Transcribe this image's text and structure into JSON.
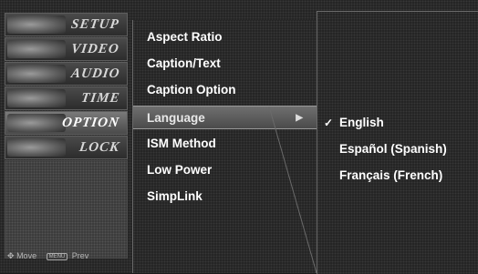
{
  "sidebar": {
    "items": [
      {
        "label": "SETUP",
        "icon": "setup-thumbnail-icon"
      },
      {
        "label": "VIDEO",
        "icon": "video-thumbnail-icon"
      },
      {
        "label": "AUDIO",
        "icon": "audio-thumbnail-icon"
      },
      {
        "label": "TIME",
        "icon": "time-thumbnail-icon"
      },
      {
        "label": "OPTION",
        "icon": "option-thumbnail-icon",
        "active": true
      },
      {
        "label": "LOCK",
        "icon": "lock-thumbnail-icon"
      }
    ],
    "hint": {
      "move_label": "Move",
      "prev_key": "MENU",
      "prev_label": "Prev"
    }
  },
  "menu": {
    "items": [
      {
        "label": "Aspect Ratio"
      },
      {
        "label": "Caption/Text"
      },
      {
        "label": "Caption Option"
      },
      {
        "label": "Language",
        "selected": true,
        "arrow": "▶"
      },
      {
        "label": "ISM Method"
      },
      {
        "label": "Low Power"
      },
      {
        "label": "SimpLink"
      }
    ]
  },
  "submenu": {
    "items": [
      {
        "label": "English",
        "checked": true,
        "check": "✓"
      },
      {
        "label": "Español (Spanish)"
      },
      {
        "label": "Français (French)"
      }
    ]
  },
  "colors": {
    "text": "#ffffff",
    "panel": "#232323",
    "highlight": "#5a5a5a"
  }
}
